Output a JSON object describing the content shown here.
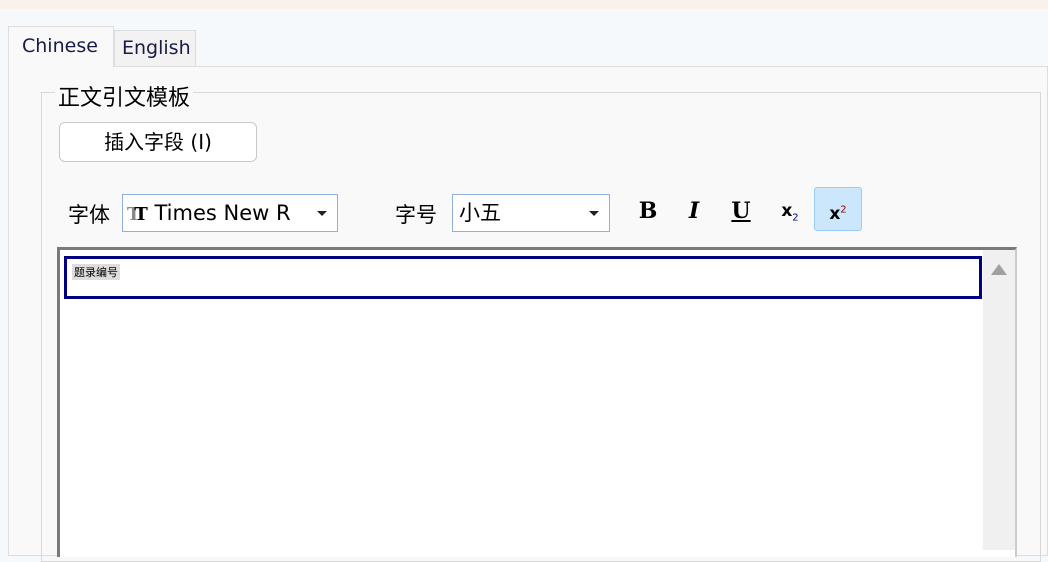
{
  "tabs": [
    {
      "label": "Chinese",
      "active": true
    },
    {
      "label": "English",
      "active": false
    }
  ],
  "group": {
    "title": "正文引文模板"
  },
  "insert_button": "插入字段 (I)",
  "font": {
    "label": "字体",
    "value": "Times New R"
  },
  "size": {
    "label": "字号",
    "value": "小五"
  },
  "format_buttons": {
    "bold": "B",
    "italic": "I",
    "underline": "U",
    "subscript": "x",
    "subscript_mark": "2",
    "superscript": "x",
    "superscript_mark": "2",
    "active": "superscript"
  },
  "editor": {
    "field_text": "题录编号"
  },
  "colors": {
    "field_border": "#000080",
    "active_button": "#cce6fc"
  }
}
